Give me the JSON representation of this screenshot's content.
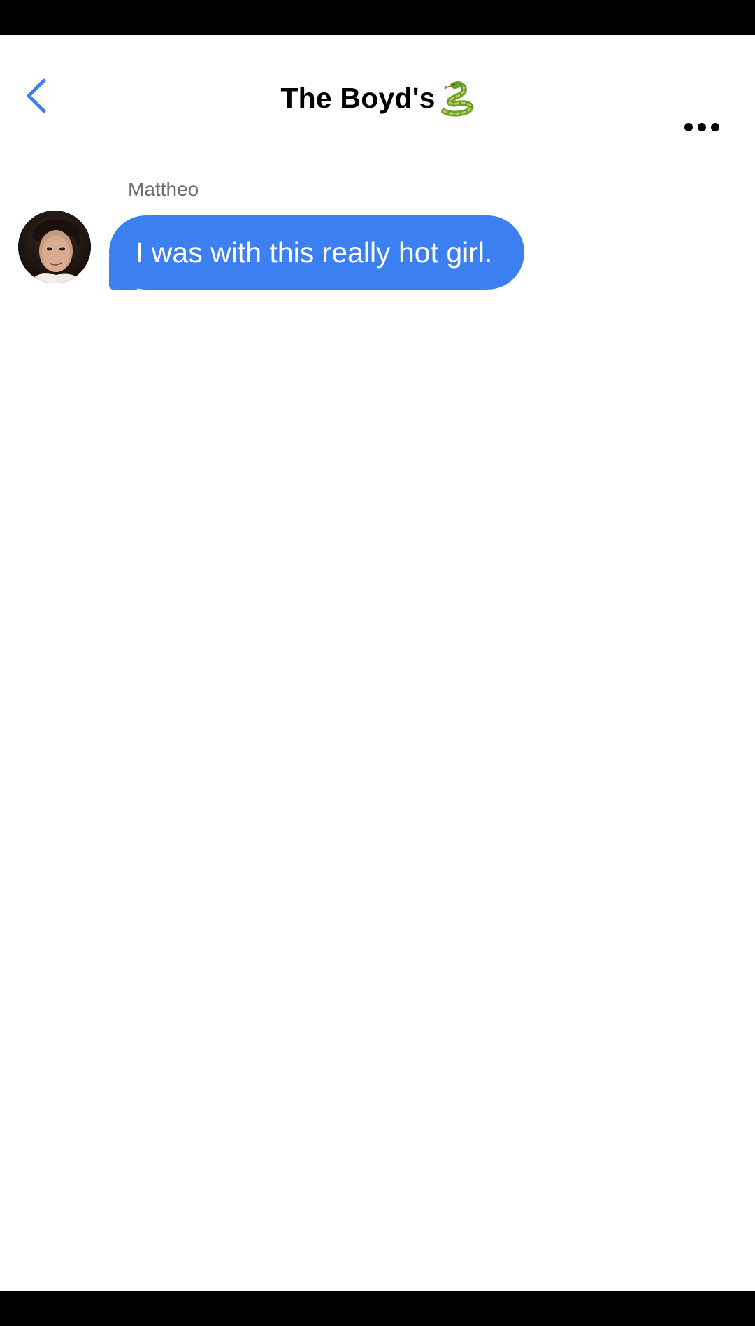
{
  "header": {
    "back_icon": "chevron-left-icon",
    "title": "The Boyd's",
    "title_emoji": "snake-emoji",
    "more_icon": "ellipsis-horizontal-icon"
  },
  "messages": [
    {
      "sender": "Mattheo",
      "text": "I was with this really hot girl.",
      "avatar": "avatar-photo"
    }
  ],
  "colors": {
    "accent": "#3b7ff0",
    "bubble_text": "#ffffff",
    "sender_name": "#6d6d72",
    "background": "#ffffff"
  }
}
